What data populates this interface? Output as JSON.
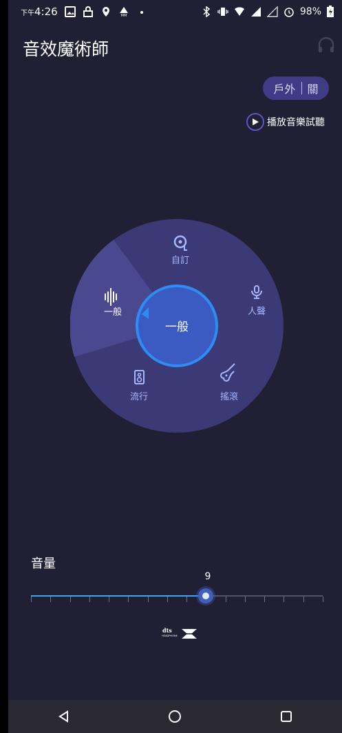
{
  "status_bar": {
    "time_prefix": "下午",
    "time": "4:26",
    "battery": "98%"
  },
  "app": {
    "title": "音效魔術師",
    "mode_toggle": {
      "label": "戶外",
      "state": "關"
    },
    "preview_label": "播放音樂試聽"
  },
  "wheel": {
    "center_label": "一般",
    "segments": [
      {
        "label": "自訂",
        "icon": "vinyl-icon"
      },
      {
        "label": "人聲",
        "icon": "microphone-icon"
      },
      {
        "label": "搖滾",
        "icon": "guitar-icon"
      },
      {
        "label": "流行",
        "icon": "speaker-icon"
      },
      {
        "label": "一般",
        "icon": "waveform-icon"
      }
    ]
  },
  "volume": {
    "label": "音量",
    "value": "9",
    "level_fraction": 0.6
  },
  "brand": {
    "dts_text": "dts",
    "dts_sub": "HEADPHONE"
  },
  "colors": {
    "background": "#211f33",
    "accent": "#3f5fb8",
    "wheel": "#3c3a76",
    "highlight": "#4a4990"
  }
}
